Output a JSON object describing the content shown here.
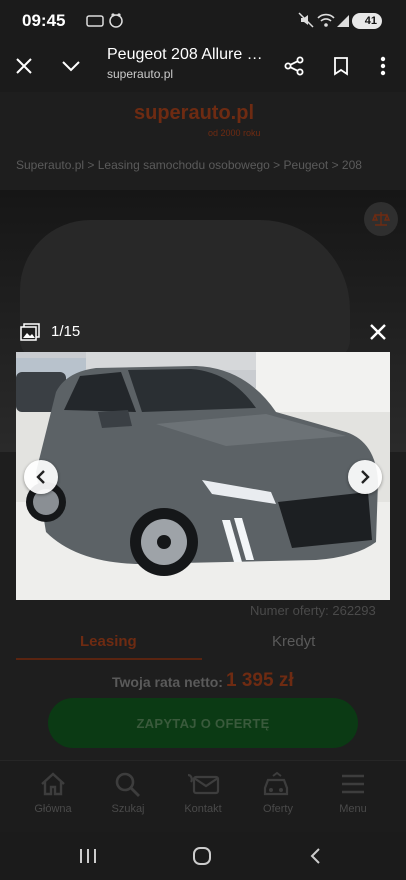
{
  "status_bar": {
    "time": "09:45",
    "battery": "41",
    "icons": [
      "lte-icon",
      "temu-icon",
      "mute-icon",
      "wifi-icon",
      "signal-icon",
      "battery-icon"
    ]
  },
  "toolbar": {
    "title": "Peugeot 208 Allure …",
    "url": "superauto.pl",
    "icons": [
      "close-icon",
      "chevron-down-icon",
      "share-icon",
      "bookmark-icon",
      "more-vert-icon"
    ]
  },
  "site": {
    "logo": "superauto.pl",
    "tagline": "od 2000 roku",
    "breadcrumb": "Superauto.pl > Leasing samochodu osobowego > Peugeot > 208"
  },
  "lightbox": {
    "counter": "1/15",
    "icons": [
      "gallery-icon",
      "close-icon",
      "chevron-left-icon",
      "chevron-right-icon"
    ]
  },
  "offer": {
    "offer_number": "Numer oferty: 262293",
    "tabs": [
      "Leasing",
      "Kredyt"
    ],
    "rate_label": "Twoja rata netto:",
    "rate_value": "1 395 zł",
    "cta": "ZAPYTAJ O OFERTĘ"
  },
  "bottom_nav": [
    {
      "label": "Główna",
      "icon": "home-icon"
    },
    {
      "label": "Szukaj",
      "icon": "search-icon"
    },
    {
      "label": "Kontakt",
      "icon": "contact-icon"
    },
    {
      "label": "Oferty",
      "icon": "car-icon"
    },
    {
      "label": "Menu",
      "icon": "menu-icon"
    }
  ],
  "colors": {
    "brand": "#e0531f",
    "cta_green": "#1fa33b",
    "car_gray": "#5c6266"
  }
}
